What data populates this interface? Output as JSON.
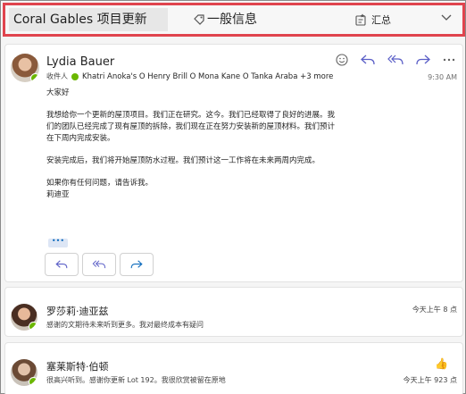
{
  "header": {
    "subject": "Coral Gables 项目更新",
    "category": "一般信息",
    "summary": "汇总"
  },
  "message": {
    "sender": "Lydia Bauer",
    "to_label": "收件人",
    "recipients": "Khatri Anoka's O Henry Brill O Mona Kane O Tanka Araba +3 more",
    "time": "9:30 AM",
    "greeting": "大家好",
    "para1": "我想给你一个更新的屋顶项目。我们正在研究。这今。我们已经取得了良好的进展。我们的团队已经完成了现有屋顶的拆除，我们现在正在努力安装新的屋顶材料。我们预计在下周内完成安装。",
    "para2": "安装完成后，我们将开始屋顶防水过程。我们预计这一工作将在未来两周内完成。",
    "para3a": "如果你有任何问题，请告诉我。",
    "para3b": "莉迪亚",
    "more": "•••"
  },
  "thread": [
    {
      "name": "罗莎莉·迪亚兹",
      "preview": "感谢的文期待未来听到更多。我对最终成本有疑问",
      "time": "今天上午 8 点"
    },
    {
      "name": "塞莱斯特·伯顿",
      "preview": "很高兴听到。感谢你更新 Lot 192。我很欣赏被留在原地",
      "time": "今天上午 923 点"
    }
  ],
  "icons": {
    "tag": "tag-icon",
    "summary": "summary-icon",
    "chevron": "chevron-down-icon",
    "emoji": "emoji-icon",
    "reply": "reply-icon",
    "reply_all": "reply-all-icon",
    "forward": "forward-icon",
    "more": "more-icon",
    "thumb": "thumbs-up-icon"
  },
  "colors": {
    "accent": "#0f6cbd",
    "highlight_border": "#e0444e",
    "presence": "#6bb700"
  }
}
